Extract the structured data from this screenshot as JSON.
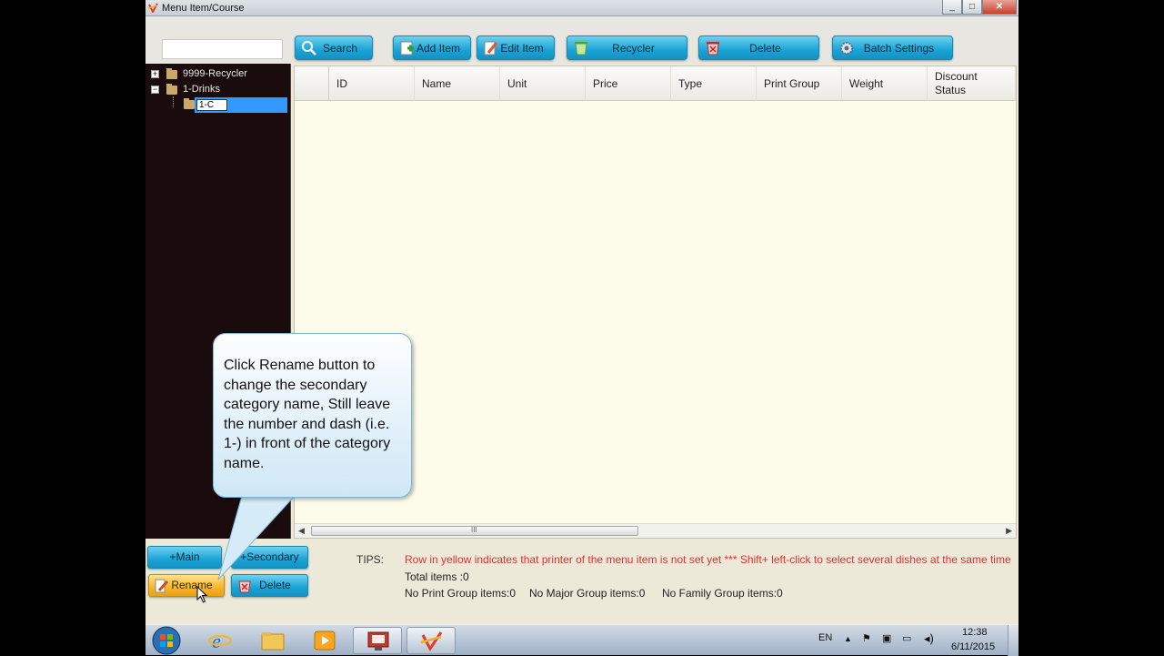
{
  "window": {
    "title": "Menu Item/Course",
    "buttons": [
      "_",
      "□",
      "✕"
    ]
  },
  "toolbar": {
    "search_value": "",
    "buttons": [
      {
        "label": "Search",
        "icon": "search-icon"
      },
      {
        "label": "Add Item",
        "icon": "add-item-icon"
      },
      {
        "label": "Edit Item",
        "icon": "edit-icon"
      },
      {
        "label": "Recycler",
        "icon": "recycler-icon"
      },
      {
        "label": "Delete",
        "icon": "delete-icon"
      },
      {
        "label": "Batch Settings",
        "icon": "gear-icon"
      }
    ]
  },
  "tree": {
    "items": [
      {
        "label": "9999-Recycler",
        "toggle": "+"
      },
      {
        "label": "1-Drinks",
        "toggle": "−"
      },
      {
        "label": "1-C",
        "editing": true
      }
    ]
  },
  "grid": {
    "columns": [
      "ID",
      "Name",
      "Unit",
      "Price",
      "Type",
      "Print Group",
      "Weight",
      "Discount Status"
    ],
    "rows": [],
    "scroll_grip": "III"
  },
  "bottom": {
    "main_label": "+Main",
    "secondary_label": "+Secondary",
    "rename_label": "Rename",
    "delete_label": "Delete",
    "tips_label": "TIPS:",
    "tips_text": "Row in yellow indicates that printer of the menu item is not set yet *** Shift+ left-click to select several dishes at the same time",
    "total_items": "Total items :0",
    "print_group": "No Print Group items:0",
    "major_group": "No Major Group items:0",
    "family_group": "No Family Group items:0"
  },
  "callout": {
    "text": "Click Rename button to change the secondary category name, Still leave the number and dash (i.e. 1-) in front of the category name."
  },
  "taskbar": {
    "lang": "EN",
    "time": "12:38",
    "date": "6/11/2015"
  },
  "colors": {
    "accent": "#1aa3d6",
    "tips": "#e0312f",
    "rename": "#f6b52c",
    "selection": "#3399ff"
  }
}
